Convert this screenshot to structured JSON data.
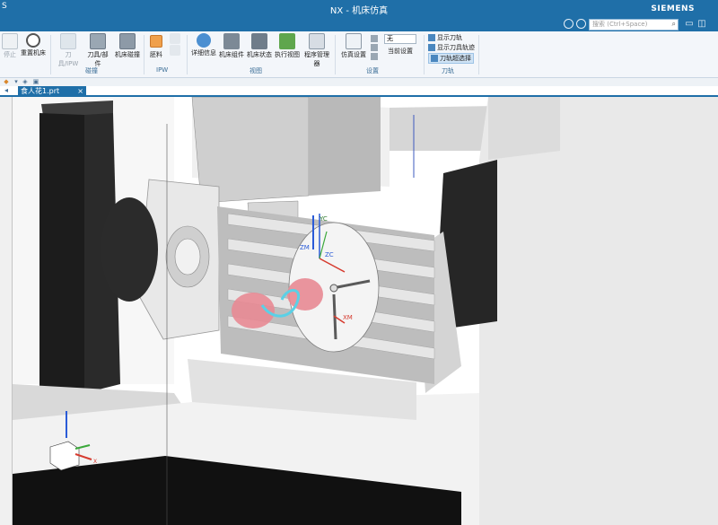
{
  "titlebar": {
    "left_glyph": "S",
    "title": "NX - 机床仿真",
    "brand": "SIEMENS"
  },
  "search": {
    "placeholder": "搜索 (Ctrl+Space)"
  },
  "ribbon": {
    "buttons": {
      "stop": "停止",
      "reset_machine": "重置机床",
      "tool_ipw": "刀具/IPW",
      "tool_part": "刀具/部件",
      "machine_collision": "机床碰撞",
      "stock": "胚料",
      "detail_info": "详细信息",
      "machine_assembly": "机床组件",
      "machine_status": "机床状态",
      "execute_view": "执行视图",
      "program_manager": "程序管理器",
      "sim_settings": "仿真设置",
      "current_settings": "当前设置"
    },
    "input_value": "无",
    "toolpath_commands": [
      "显示刀轨",
      "显示刀具轨迹",
      "刀轨超选择"
    ],
    "groups": {
      "collision": "碰撞",
      "ipw": "IPW",
      "view": "视图",
      "settings": "设置",
      "toolpath": "刀轨"
    }
  },
  "tab": {
    "label": "食人花1.prt",
    "close": "×"
  },
  "viewport": {
    "axis_labels": {
      "yc": "YC",
      "zm": "ZM",
      "zc": "ZC",
      "xm": "XM",
      "triad_x": "X"
    }
  },
  "colors": {
    "accent": "#1f6fa8",
    "part": "#e88a94",
    "toolpath": "#5ad0e6",
    "axis_z": "#2a5bd7",
    "axis_x": "#d63a2e",
    "axis_y": "#3aa83a"
  }
}
